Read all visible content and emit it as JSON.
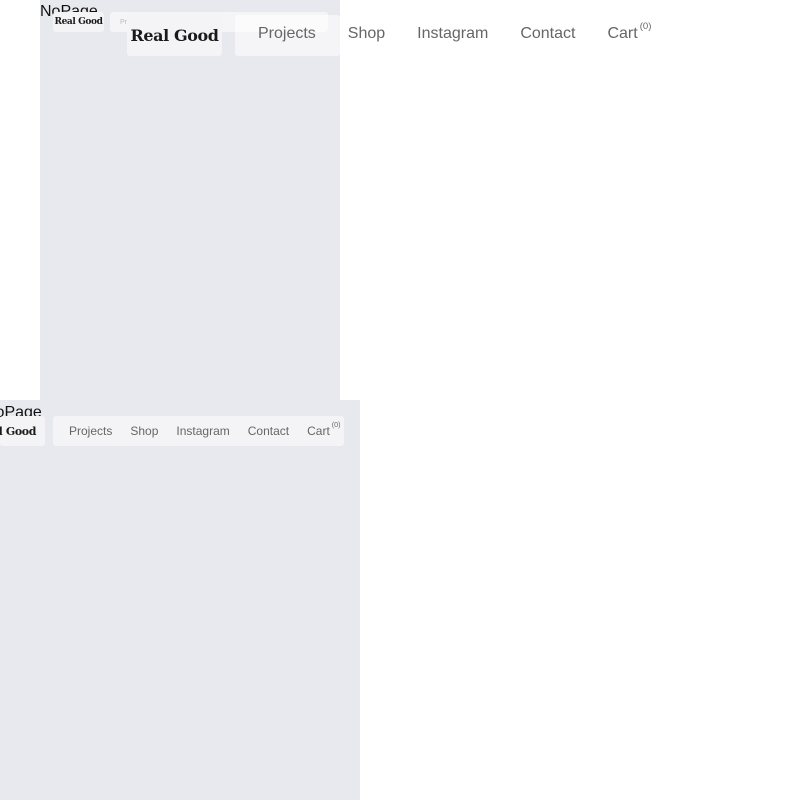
{
  "page_label": "NoPage",
  "brand": {
    "logo_text": "Real Good"
  },
  "nav": {
    "projects": "Projects",
    "shop": "Shop",
    "instagram": "Instagram",
    "contact": "Contact",
    "cart": "Cart",
    "cart_count": "(0)"
  },
  "colors": {
    "panel_bg": "#e8e9ee",
    "nav_text": "#666666",
    "logo_text": "#1a1a1a"
  }
}
